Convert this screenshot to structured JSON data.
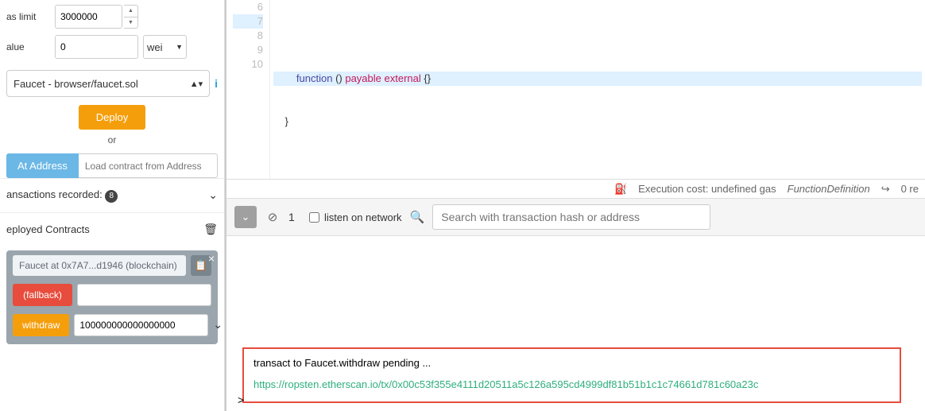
{
  "sidebar": {
    "gas_limit_label": "as limit",
    "gas_limit_value": "3000000",
    "value_label": "alue",
    "value_value": "0",
    "value_unit": "wei",
    "contract_selected": "Faucet - browser/faucet.sol",
    "deploy_label": "Deploy",
    "or_label": "or",
    "ataddress_label": "At Address",
    "ataddress_placeholder": "Load contract from Address",
    "tx_recorded_label": "ansactions recorded:",
    "tx_recorded_count": "8",
    "deployed_label": "eployed Contracts",
    "instance_title": "Faucet at 0x7A7...d1946 (blockchain)",
    "fn_fallback": "(fallback)",
    "fn_withdraw": "withdraw",
    "withdraw_input_value": "100000000000000000"
  },
  "editor": {
    "lines": [
      "6",
      "7",
      "8",
      "9",
      "10"
    ],
    "line7_func": "function",
    "line7_paren": " () ",
    "line7_payable": "payable",
    "line7_external": " external",
    "line7_braces": " {}",
    "line8": "    }"
  },
  "statusbar": {
    "exec_cost": "Execution cost: undefined gas",
    "fn_def": "FunctionDefinition",
    "cnt": "0 re"
  },
  "console": {
    "pending_count": "1",
    "listen_label": "listen on network",
    "search_placeholder": "Search with transaction hash or address",
    "tx_msg": "transact to Faucet.withdraw pending ...",
    "tx_link": "https://ropsten.etherscan.io/tx/0x00c53f355e4111d20511a5c126a595cd4999df81b51b1c1c74661d781c60a23c",
    "prompt": ">"
  }
}
